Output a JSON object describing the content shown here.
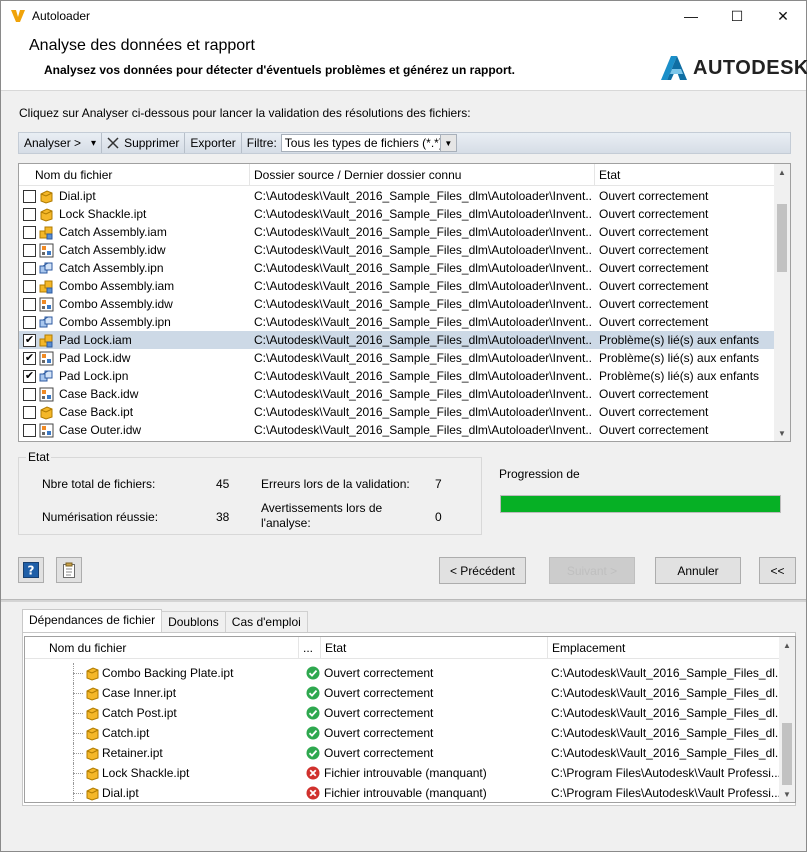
{
  "window": {
    "title": "Autoloader",
    "min_glyph": "—",
    "max_glyph": "☐",
    "close_glyph": "✕"
  },
  "header": {
    "title": "Analyse des données et rapport",
    "subtitle": "Analysez vos données pour détecter d'éventuels problèmes et générez un rapport.",
    "brand": "AUTODESK."
  },
  "intro": "Cliquez sur Analyser ci-dessous pour lancer la validation des résolutions des fichiers:",
  "toolbar": {
    "analyze": "Analyser >",
    "analyze_dd": "▾",
    "delete": "Supprimer",
    "export": "Exporter",
    "filter_label": "Filtre:",
    "filter_value": "Tous les types de fichiers (*.*)"
  },
  "files": {
    "columns": [
      "Nom du fichier",
      "Dossier source / Dernier dossier connu",
      "Etat"
    ],
    "rows": [
      {
        "name": "Dial.ipt",
        "path": "C:\\Autodesk\\Vault_2016_Sample_Files_dlm\\Autoloader\\Invent...",
        "state": "Ouvert correctement",
        "checked": false,
        "type": "ipt",
        "mark": ""
      },
      {
        "name": "Lock Shackle.ipt",
        "path": "C:\\Autodesk\\Vault_2016_Sample_Files_dlm\\Autoloader\\Invent...",
        "state": "Ouvert correctement",
        "checked": false,
        "type": "ipt",
        "mark": ""
      },
      {
        "name": "Catch Assembly.iam",
        "path": "C:\\Autodesk\\Vault_2016_Sample_Files_dlm\\Autoloader\\Invent...",
        "state": "Ouvert correctement",
        "checked": false,
        "type": "iam",
        "mark": ""
      },
      {
        "name": "Catch Assembly.idw",
        "path": "C:\\Autodesk\\Vault_2016_Sample_Files_dlm\\Autoloader\\Invent...",
        "state": "Ouvert correctement",
        "checked": false,
        "type": "idw",
        "mark": ""
      },
      {
        "name": "Catch Assembly.ipn",
        "path": "C:\\Autodesk\\Vault_2016_Sample_Files_dlm\\Autoloader\\Invent...",
        "state": "Ouvert correctement",
        "checked": false,
        "type": "ipn",
        "mark": ""
      },
      {
        "name": "Combo Assembly.iam",
        "path": "C:\\Autodesk\\Vault_2016_Sample_Files_dlm\\Autoloader\\Invent...",
        "state": "Ouvert correctement",
        "checked": false,
        "type": "iam",
        "mark": ""
      },
      {
        "name": "Combo Assembly.idw",
        "path": "C:\\Autodesk\\Vault_2016_Sample_Files_dlm\\Autoloader\\Invent...",
        "state": "Ouvert correctement",
        "checked": false,
        "type": "idw",
        "mark": ""
      },
      {
        "name": "Combo Assembly.ipn",
        "path": "C:\\Autodesk\\Vault_2016_Sample_Files_dlm\\Autoloader\\Invent...",
        "state": "Ouvert correctement",
        "checked": false,
        "type": "ipn",
        "mark": ""
      },
      {
        "name": "Pad Lock.iam",
        "path": "C:\\Autodesk\\Vault_2016_Sample_Files_dlm\\Autoloader\\Invent...",
        "state": "Problème(s) lié(s) aux enfants",
        "checked": true,
        "type": "iam",
        "mark": "✔"
      },
      {
        "name": "Pad Lock.idw",
        "path": "C:\\Autodesk\\Vault_2016_Sample_Files_dlm\\Autoloader\\Invent...",
        "state": "Problème(s) lié(s) aux enfants",
        "checked": true,
        "type": "idw",
        "mark": "✔"
      },
      {
        "name": "Pad Lock.ipn",
        "path": "C:\\Autodesk\\Vault_2016_Sample_Files_dlm\\Autoloader\\Invent...",
        "state": "Problème(s) lié(s) aux enfants",
        "checked": true,
        "type": "ipn",
        "mark": "✔"
      },
      {
        "name": "Case Back.idw",
        "path": "C:\\Autodesk\\Vault_2016_Sample_Files_dlm\\Autoloader\\Invent...",
        "state": "Ouvert correctement",
        "checked": false,
        "type": "idw",
        "mark": ""
      },
      {
        "name": "Case Back.ipt",
        "path": "C:\\Autodesk\\Vault_2016_Sample_Files_dlm\\Autoloader\\Invent...",
        "state": "Ouvert correctement",
        "checked": false,
        "type": "ipt",
        "mark": ""
      },
      {
        "name": "Case Outer.idw",
        "path": "C:\\Autodesk\\Vault_2016_Sample_Files_dlm\\Autoloader\\Invent...",
        "state": "Ouvert correctement",
        "checked": false,
        "type": "idw",
        "mark": ""
      }
    ],
    "selected_index": 8
  },
  "status": {
    "group_label": "Etat",
    "total_label": "Nbre total de fichiers:",
    "total_value": "45",
    "scan_label": "Numérisation réussie:",
    "scan_value": "38",
    "errors_label": "Erreurs lors de la validation:",
    "errors_value": "7",
    "warnings_label": "Avertissements lors de l'analyse:",
    "warnings_value": "0",
    "progress_label": "Progression de",
    "progress_fraction": 1.0
  },
  "buttons": {
    "prev": "< Précédent",
    "next": "Suivant >",
    "cancel": "Annuler",
    "collapse": "<<"
  },
  "tabs": [
    "Dépendances de fichier",
    "Doublons",
    "Cas d'emploi"
  ],
  "deps": {
    "columns": [
      "Nom du fichier",
      "...",
      "Etat",
      "Emplacement"
    ],
    "rows": [
      {
        "name": "Combo Backing Plate.ipt",
        "state": "Ouvert correctement",
        "location": "C:\\Autodesk\\Vault_2016_Sample_Files_dl...",
        "ok": true
      },
      {
        "name": "Case Inner.ipt",
        "state": "Ouvert correctement",
        "location": "C:\\Autodesk\\Vault_2016_Sample_Files_dl...",
        "ok": true
      },
      {
        "name": "Catch Post.ipt",
        "state": "Ouvert correctement",
        "location": "C:\\Autodesk\\Vault_2016_Sample_Files_dl...",
        "ok": true
      },
      {
        "name": "Catch.ipt",
        "state": "Ouvert correctement",
        "location": "C:\\Autodesk\\Vault_2016_Sample_Files_dl...",
        "ok": true
      },
      {
        "name": "Retainer.ipt",
        "state": "Ouvert correctement",
        "location": "C:\\Autodesk\\Vault_2016_Sample_Files_dl...",
        "ok": true
      },
      {
        "name": "Lock Shackle.ipt",
        "state": "Fichier introuvable (manquant)",
        "location": "C:\\Program Files\\Autodesk\\Vault Professi...",
        "ok": false
      },
      {
        "name": "Dial.ipt",
        "state": "Fichier introuvable (manquant)",
        "location": "C:\\Program Files\\Autodesk\\Vault Professi...",
        "ok": false
      }
    ]
  },
  "colors": {
    "progress": "#06b025",
    "selection": "#cdd9e6",
    "ok": "#2fa84f",
    "error": "#d0312d",
    "part": "#f4b728"
  }
}
